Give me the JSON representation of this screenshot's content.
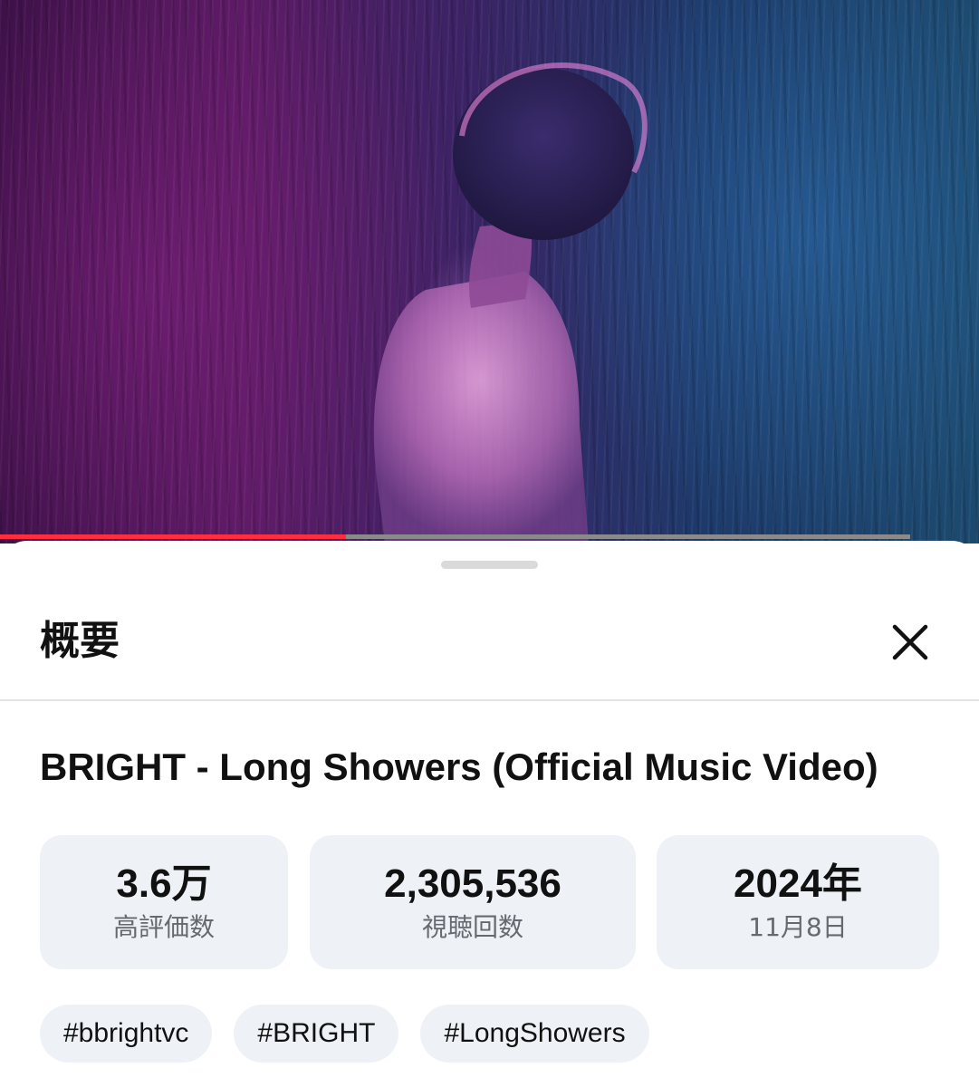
{
  "player": {
    "progress_fraction": 0.38,
    "progress_color": "#ff2d3e"
  },
  "panel": {
    "title": "概要",
    "close_icon": "close-icon"
  },
  "video": {
    "title": "BRIGHT - Long Showers (Official Music Video)"
  },
  "stats": [
    {
      "value": "3.6万",
      "label": "高評価数"
    },
    {
      "value": "2,305,536",
      "label": "視聴回数"
    },
    {
      "value": "2024年",
      "label": "11月8日"
    }
  ],
  "hashtags": [
    "#bbrightvc",
    "#BRIGHT",
    "#LongShowers"
  ]
}
